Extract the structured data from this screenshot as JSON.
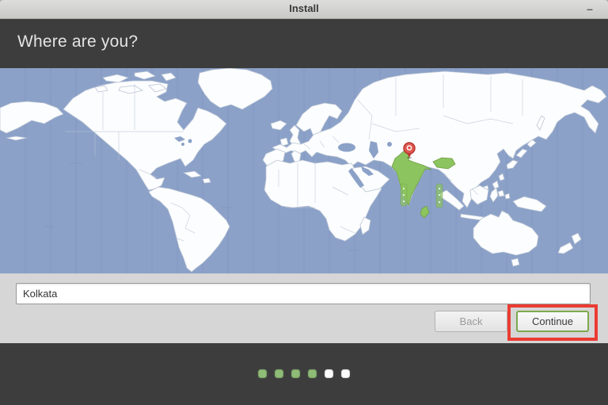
{
  "window": {
    "title": "Install",
    "minimize_glyph": "–"
  },
  "header": {
    "title": "Where are you?"
  },
  "location_field": {
    "value": "Kolkata"
  },
  "actions": {
    "back_label": "Back",
    "continue_label": "Continue"
  },
  "progress": {
    "dots": [
      "done",
      "done",
      "done",
      "done",
      "todo",
      "todo"
    ]
  },
  "colors": {
    "ocean": "#8ba1c8",
    "land": "#fcfdfe",
    "land_border": "#bac4d4",
    "timezone_line": "#7c92bb",
    "highlight": "#8cc45f",
    "highlight_border": "#6e9e45",
    "pin": "#e05a52",
    "pin_border": "#b93632",
    "annotation": "#ea3c33",
    "accent_green_border": "#7ca94e",
    "dot_done": "#8fbc77",
    "dot_todo": "#fbfbfb",
    "header_bg": "#3d3d3d",
    "body_bg": "#d6d6d6",
    "titlebar_text": "#3a3a3a"
  }
}
